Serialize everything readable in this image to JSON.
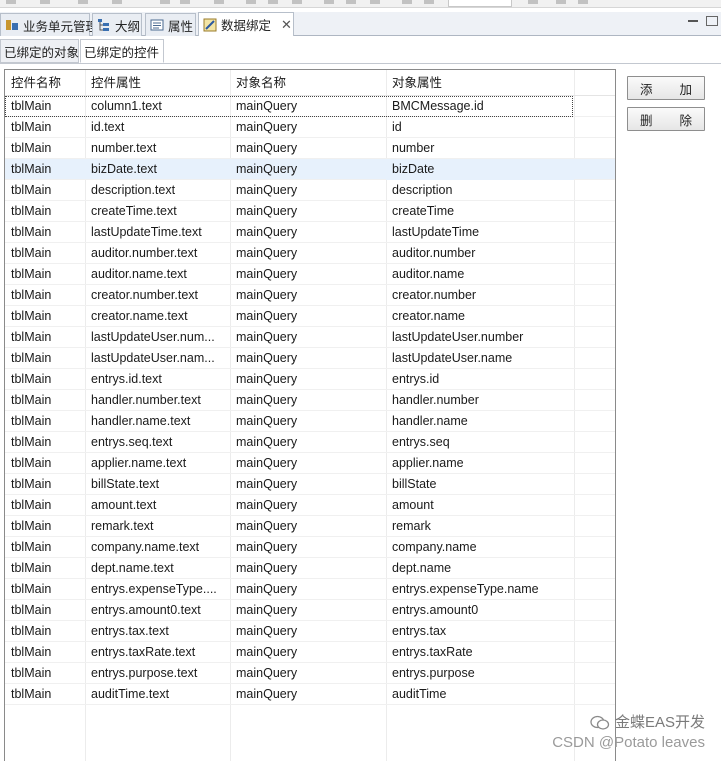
{
  "view_tabs": [
    {
      "label": "业务单元管理",
      "icon": "org-unit-icon"
    },
    {
      "label": "大纲",
      "icon": "outline-icon"
    },
    {
      "label": "属性",
      "icon": "properties-icon"
    },
    {
      "label": "数据绑定",
      "icon": "data-binding-icon",
      "closable": true
    }
  ],
  "sub_tabs": [
    "已绑定的对象",
    "已绑定的控件"
  ],
  "table": {
    "headers": [
      "控件名称",
      "控件属性",
      "对象名称",
      "对象属性"
    ],
    "rows": [
      [
        "tblMain",
        "column1.text",
        "mainQuery",
        "BMCMessage.id"
      ],
      [
        "tblMain",
        "id.text",
        "mainQuery",
        "id"
      ],
      [
        "tblMain",
        "number.text",
        "mainQuery",
        "number"
      ],
      [
        "tblMain",
        "bizDate.text",
        "mainQuery",
        "bizDate"
      ],
      [
        "tblMain",
        "description.text",
        "mainQuery",
        "description"
      ],
      [
        "tblMain",
        "createTime.text",
        "mainQuery",
        "createTime"
      ],
      [
        "tblMain",
        "lastUpdateTime.text",
        "mainQuery",
        "lastUpdateTime"
      ],
      [
        "tblMain",
        "auditor.number.text",
        "mainQuery",
        "auditor.number"
      ],
      [
        "tblMain",
        "auditor.name.text",
        "mainQuery",
        "auditor.name"
      ],
      [
        "tblMain",
        "creator.number.text",
        "mainQuery",
        "creator.number"
      ],
      [
        "tblMain",
        "creator.name.text",
        "mainQuery",
        "creator.name"
      ],
      [
        "tblMain",
        "lastUpdateUser.num...",
        "mainQuery",
        "lastUpdateUser.number"
      ],
      [
        "tblMain",
        "lastUpdateUser.nam...",
        "mainQuery",
        "lastUpdateUser.name"
      ],
      [
        "tblMain",
        "entrys.id.text",
        "mainQuery",
        "entrys.id"
      ],
      [
        "tblMain",
        "handler.number.text",
        "mainQuery",
        "handler.number"
      ],
      [
        "tblMain",
        "handler.name.text",
        "mainQuery",
        "handler.name"
      ],
      [
        "tblMain",
        "entrys.seq.text",
        "mainQuery",
        "entrys.seq"
      ],
      [
        "tblMain",
        "applier.name.text",
        "mainQuery",
        "applier.name"
      ],
      [
        "tblMain",
        "billState.text",
        "mainQuery",
        "billState"
      ],
      [
        "tblMain",
        "amount.text",
        "mainQuery",
        "amount"
      ],
      [
        "tblMain",
        "remark.text",
        "mainQuery",
        "remark"
      ],
      [
        "tblMain",
        "company.name.text",
        "mainQuery",
        "company.name"
      ],
      [
        "tblMain",
        "dept.name.text",
        "mainQuery",
        "dept.name"
      ],
      [
        "tblMain",
        "entrys.expenseType....",
        "mainQuery",
        "entrys.expenseType.name"
      ],
      [
        "tblMain",
        "entrys.amount0.text",
        "mainQuery",
        "entrys.amount0"
      ],
      [
        "tblMain",
        "entrys.tax.text",
        "mainQuery",
        "entrys.tax"
      ],
      [
        "tblMain",
        "entrys.taxRate.text",
        "mainQuery",
        "entrys.taxRate"
      ],
      [
        "tblMain",
        "entrys.purpose.text",
        "mainQuery",
        "entrys.purpose"
      ],
      [
        "tblMain",
        "auditTime.text",
        "mainQuery",
        "auditTime"
      ]
    ]
  },
  "buttons": {
    "add": [
      "添",
      "加"
    ],
    "delete": [
      "删",
      "除"
    ]
  },
  "watermark": {
    "line1": "金蝶EAS开发",
    "line2": "CSDN @Potato leaves"
  }
}
